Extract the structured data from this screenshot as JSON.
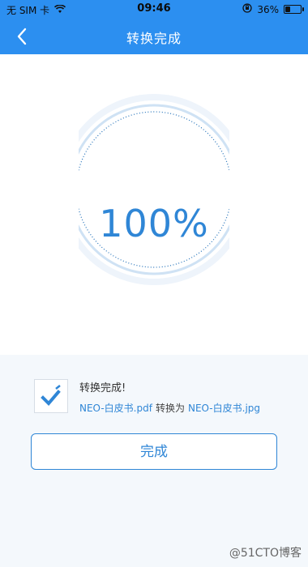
{
  "status_bar": {
    "carrier": "无 SIM 卡",
    "time": "09:46",
    "battery_percent": "36%",
    "battery_level": 0.36,
    "icons": [
      "wifi-icon",
      "orientation-lock-icon",
      "battery-icon"
    ]
  },
  "navbar": {
    "title": "转换完成",
    "back_icon": "chevron-left-icon"
  },
  "progress": {
    "value": 100,
    "label": "100%"
  },
  "result": {
    "title": "转换完成!",
    "source_file": "NEO-白皮书.pdf",
    "conversion_word": "转换为",
    "target_file": "NEO-白皮书.jpg",
    "icon": "checkmark-icon"
  },
  "actions": {
    "done_label": "完成"
  },
  "watermark": "@51CTO博客",
  "colors": {
    "accent": "#2c8ff0",
    "link": "#2f86d6",
    "ring_light": "#e9f1fa",
    "ring_mid": "#cfe2f4"
  }
}
